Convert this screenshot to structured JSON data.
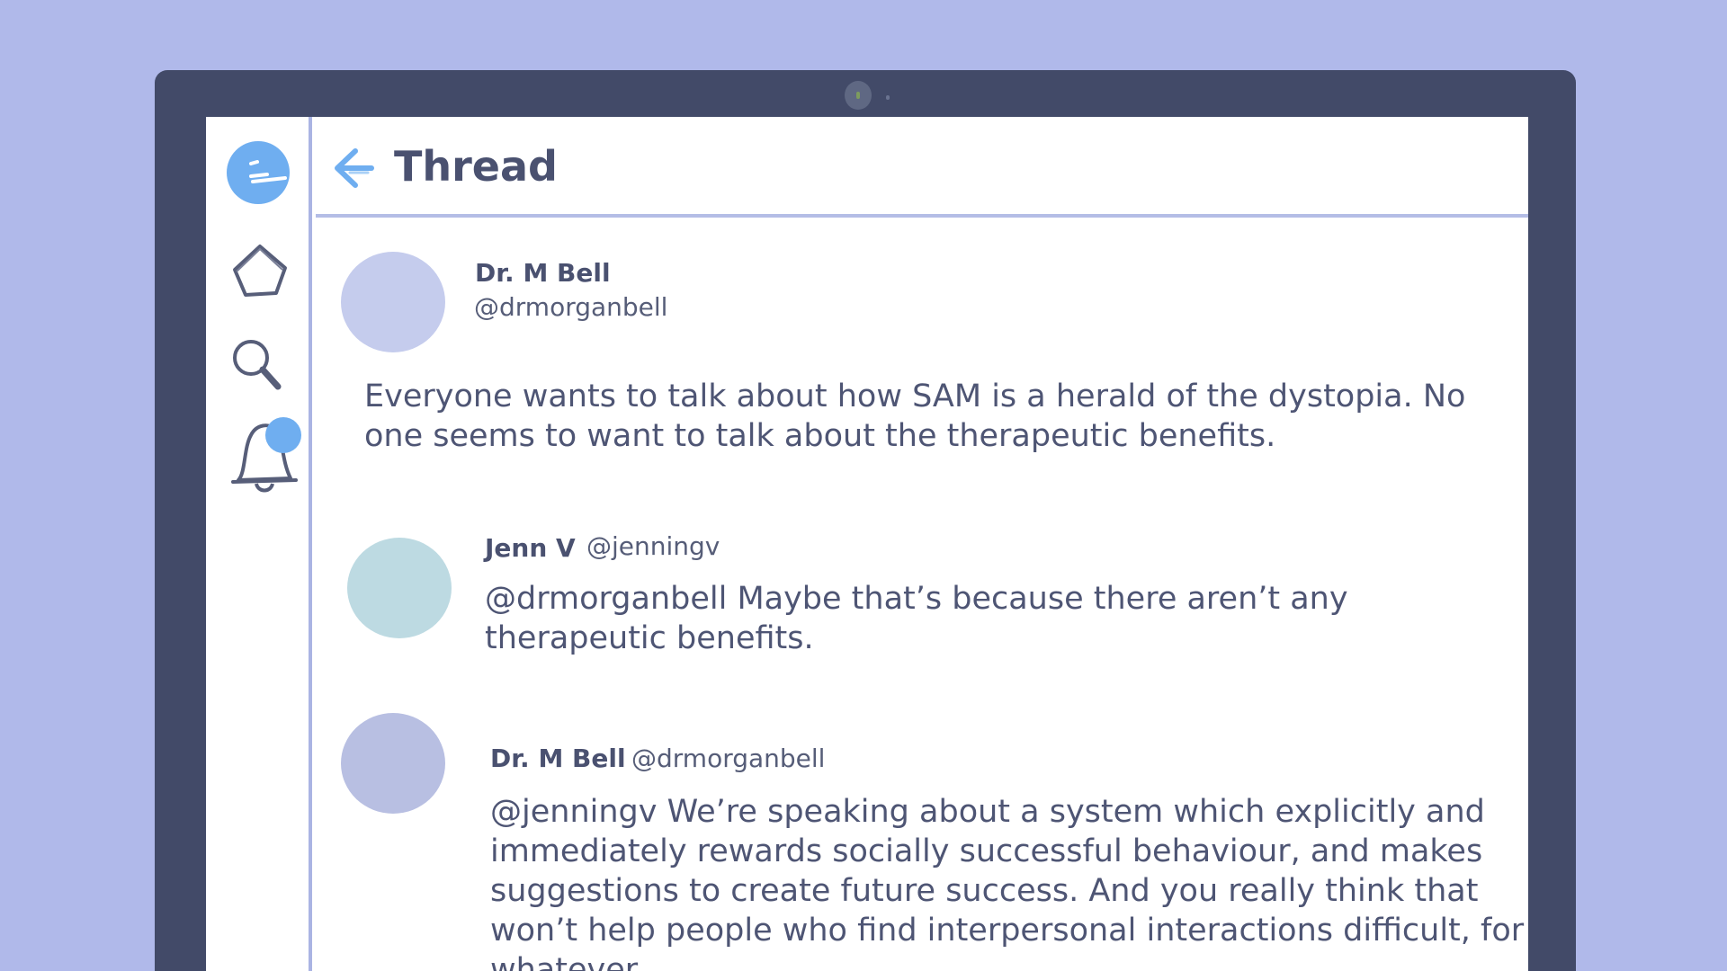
{
  "colors": {
    "background": "#b0b9ea",
    "frame": "#424a68",
    "accent_blue": "#6faef0",
    "divider": "#aab4e3",
    "text": "#4a5170"
  },
  "icons": {
    "logo": "face-logo-icon",
    "home": "home-icon",
    "search": "search-icon",
    "notifications": "bell-icon",
    "back": "back-arrow-icon"
  },
  "header": {
    "title": "Thread"
  },
  "thread": {
    "posts": [
      {
        "name": "Dr. M Bell",
        "handle": "@drmorganbell",
        "text": "Everyone wants to talk about how SAM is a herald of the dystopia. No one seems to want to talk about the therapeutic benefits."
      },
      {
        "name": "Jenn V",
        "handle": "@jenningv",
        "text": "@drmorganbell Maybe that’s because there aren’t any therapeutic benefits."
      },
      {
        "name": "Dr. M Bell",
        "handle": "@drmorganbell",
        "text": "@jenningv We’re speaking about a system which explicitly and immediately rewards socially successful behaviour, and makes suggestions to create future success. And you really think that won’t help people who find interpersonal interactions difficult, for whatever"
      }
    ]
  }
}
